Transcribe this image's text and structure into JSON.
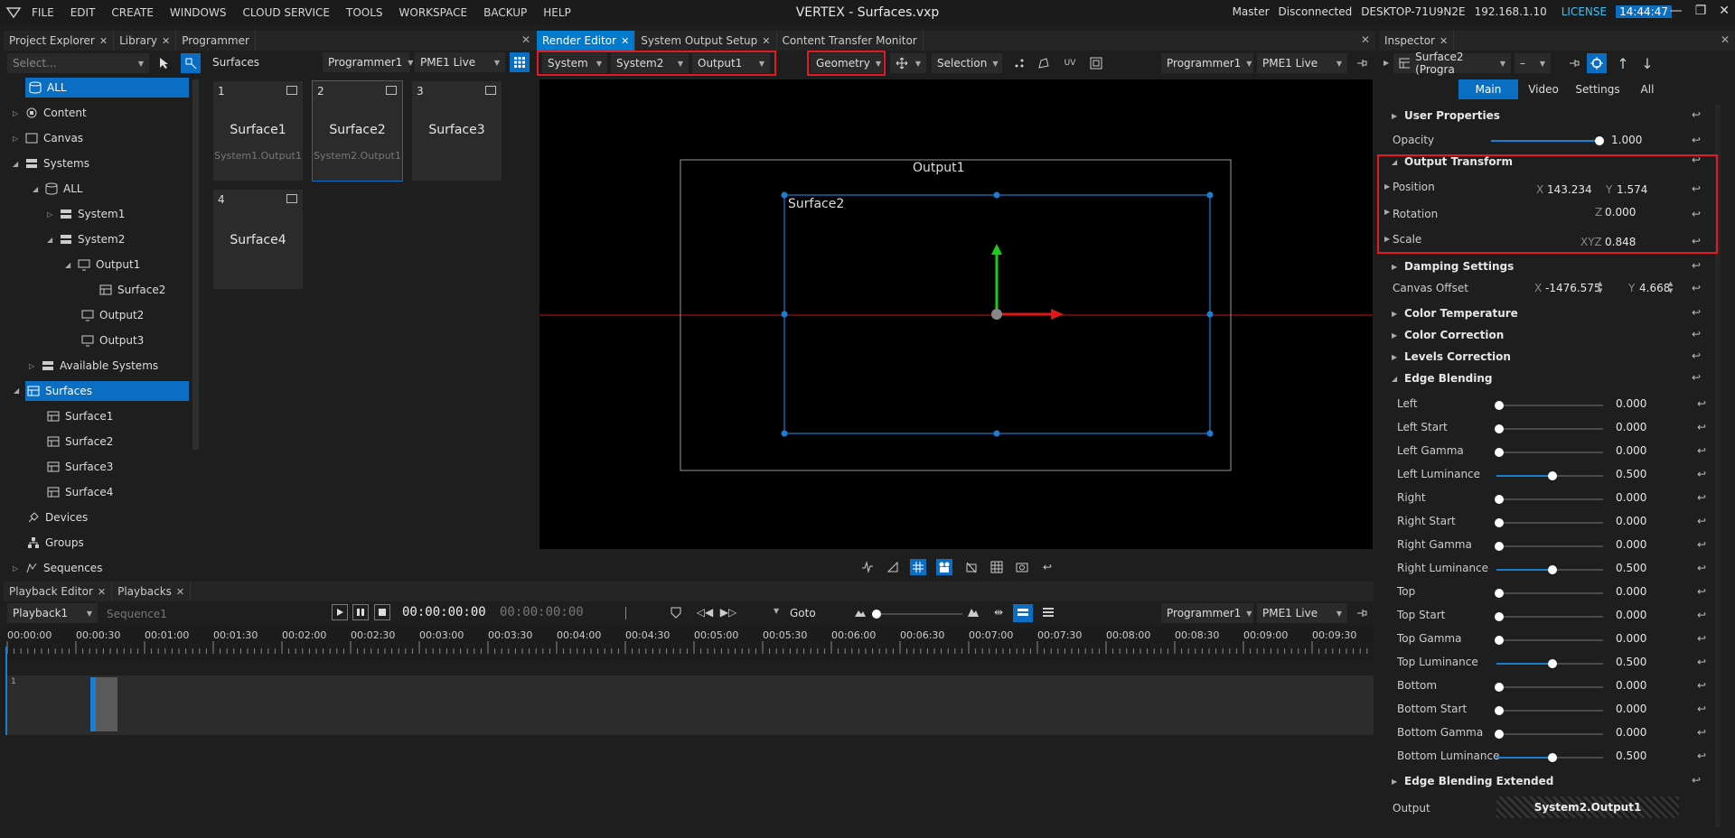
{
  "menu": {
    "items": [
      "FILE",
      "EDIT",
      "CREATE",
      "WINDOWS",
      "CLOUD SERVICE",
      "TOOLS",
      "WORKSPACE",
      "BACKUP",
      "HELP"
    ],
    "title": "VERTEX - Surfaces.vxp",
    "status": {
      "master": "Master",
      "connection": "Disconnected",
      "host": "DESKTOP-71U9N2E",
      "ip": "192.168.1.10",
      "license": "LICENSE",
      "time": "14:44:47"
    },
    "window_buttons": [
      "—",
      "❐",
      "✕"
    ]
  },
  "left_tabs": [
    "Project Explorer",
    "Library",
    "Programmer"
  ],
  "explorer": {
    "search_placeholder": "Select...",
    "tree": [
      "ALL",
      "Content",
      "Canvas",
      "Systems",
      "ALL",
      "System1",
      "System2",
      "Output1",
      "Surface2",
      "Output2",
      "Output3",
      "Available Systems",
      "Surfaces",
      "Surface1",
      "Surface2",
      "Surface3",
      "Surface4",
      "Devices",
      "Groups",
      "Sequences"
    ]
  },
  "surfaces_panel": {
    "title": "Surfaces",
    "programmer": "Programmer1",
    "live": "PME1 Live",
    "tiles": [
      {
        "num": "1",
        "name": "Surface1",
        "sub": "System1.Output1"
      },
      {
        "num": "2",
        "name": "Surface2",
        "sub": "System2.Output1"
      },
      {
        "num": "3",
        "name": "Surface3",
        "sub": ""
      },
      {
        "num": "4",
        "name": "Surface4",
        "sub": ""
      }
    ]
  },
  "center_tabs": [
    "Render Editor",
    "System Output Setup",
    "Content Transfer Monitor"
  ],
  "render_toolbar": {
    "system": "System",
    "system2": "System2",
    "output": "Output1",
    "mode": "Geometry",
    "selection": "Selection",
    "programmer": "Programmer1",
    "live": "PME1 Live"
  },
  "viewport": {
    "output_label": "Output1",
    "surface_label": "Surface2"
  },
  "inspector": {
    "tab": "Inspector",
    "target": "Surface2 (Progra",
    "subtabs": [
      "Main",
      "Video",
      "Settings",
      "All"
    ],
    "user_properties": "User Properties",
    "opacity_label": "Opacity",
    "opacity": "1.000",
    "opacity_value": 1.0,
    "output_transform": "Output Transform",
    "position_label": "Position",
    "pos_x_label": "X",
    "pos_x": "143.234",
    "pos_y_label": "Y",
    "pos_y": "1.574",
    "rotation_label": "Rotation",
    "rot_z_label": "Z",
    "rot_z": "0.000",
    "scale_label": "Scale",
    "scale_xyz_label": "XYZ",
    "scale": "0.848",
    "damping": "Damping Settings",
    "canvas_offset_label": "Canvas Offset",
    "co_x_label": "X",
    "co_x": "-1476.575",
    "co_y_label": "Y",
    "co_y": "4.668",
    "color_temp": "Color Temperature",
    "color_corr": "Color Correction",
    "levels_corr": "Levels Correction",
    "edge_blending": "Edge Blending",
    "edge_items": [
      {
        "label": "Left",
        "value": "0.000",
        "level": 0.0
      },
      {
        "label": "Left Start",
        "value": "0.000",
        "level": 0.0
      },
      {
        "label": "Left Gamma",
        "value": "0.000",
        "level": 0.0
      },
      {
        "label": "Left Luminance",
        "value": "0.500",
        "level": 0.5
      },
      {
        "label": "Right",
        "value": "0.000",
        "level": 0.0
      },
      {
        "label": "Right Start",
        "value": "0.000",
        "level": 0.0
      },
      {
        "label": "Right Gamma",
        "value": "0.000",
        "level": 0.0
      },
      {
        "label": "Right Luminance",
        "value": "0.500",
        "level": 0.5
      },
      {
        "label": "Top",
        "value": "0.000",
        "level": 0.0
      },
      {
        "label": "Top Start",
        "value": "0.000",
        "level": 0.0
      },
      {
        "label": "Top Gamma",
        "value": "0.000",
        "level": 0.0
      },
      {
        "label": "Top Luminance",
        "value": "0.500",
        "level": 0.5
      },
      {
        "label": "Bottom",
        "value": "0.000",
        "level": 0.0
      },
      {
        "label": "Bottom Start",
        "value": "0.000",
        "level": 0.0
      },
      {
        "label": "Bottom Gamma",
        "value": "0.000",
        "level": 0.0
      },
      {
        "label": "Bottom Luminance",
        "value": "0.500",
        "level": 0.5
      }
    ],
    "edge_ext": "Edge Blending Extended",
    "output_label": "Output",
    "output_value": "System2.Output1"
  },
  "bottom_tabs": [
    "Playback Editor",
    "Playbacks"
  ],
  "playback": {
    "playback": "Playback1",
    "sequence": "Sequence1",
    "tc1": "00:00:00:00",
    "tc2": "00:00:00:00",
    "goto": "Goto",
    "programmer": "Programmer1",
    "live": "PME1 Live",
    "track": "1",
    "ruler": [
      "00:00:00",
      "00:00:30",
      "00:01:00",
      "00:01:30",
      "00:02:00",
      "00:02:30",
      "00:03:00",
      "00:03:30",
      "00:04:00",
      "00:04:30",
      "00:05:00",
      "00:05:30",
      "00:06:00",
      "00:06:30",
      "00:07:00",
      "00:07:30",
      "00:08:00",
      "00:08:30",
      "00:09:00",
      "00:09:30"
    ]
  },
  "colors": {
    "accent": "#007acc",
    "selection": "#0a6fc2",
    "highlight_box": "#e11b22",
    "license": "#3fc0f0",
    "surface_outline": "#1b7fd1"
  }
}
